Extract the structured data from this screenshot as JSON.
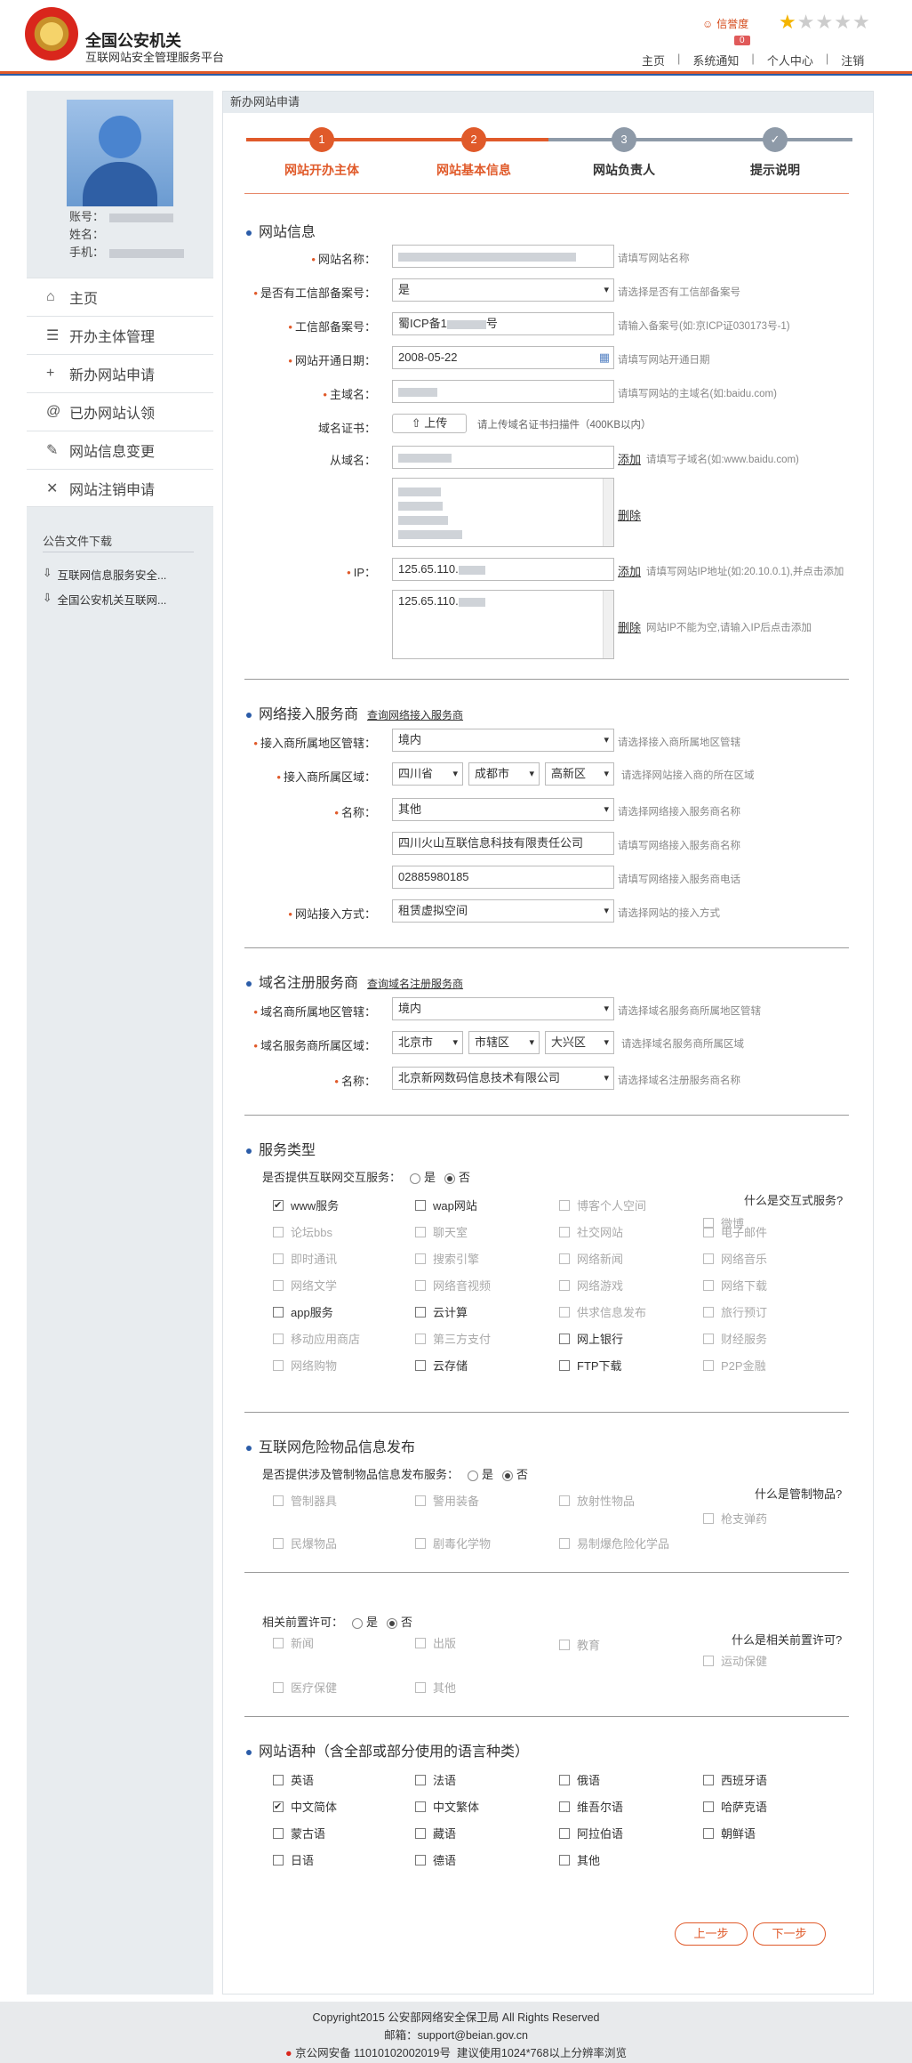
{
  "header": {
    "title": "全国公安机关",
    "subtitle": "互联网站安全管理服务平台",
    "credit_label": "信誉度",
    "credit_count": "0",
    "rating": 1,
    "rating_max": 5,
    "nav": [
      "主页",
      "系统通知",
      "个人中心",
      "注销"
    ]
  },
  "sidebar": {
    "account_label": "账号：",
    "name_label": "姓名：",
    "phone_label": "手机：",
    "menu": [
      {
        "icon": "home-icon",
        "glyph": "⌂",
        "label": "主页"
      },
      {
        "icon": "list-icon",
        "glyph": "☰",
        "label": "开办主体管理"
      },
      {
        "icon": "plus-icon",
        "glyph": "+",
        "label": "新办网站申请"
      },
      {
        "icon": "at-icon",
        "glyph": "@",
        "label": "已办网站认领"
      },
      {
        "icon": "edit-icon",
        "glyph": "✎",
        "label": "网站信息变更"
      },
      {
        "icon": "close-icon",
        "glyph": "✕",
        "label": "网站注销申请"
      }
    ],
    "notice_title": "公告文件下载",
    "docs": [
      "互联网信息服务安全...",
      "全国公安机关互联网..."
    ]
  },
  "main": {
    "breadcrumb": "新办网站申请",
    "steps": [
      {
        "num": "1",
        "label": "网站开办主体",
        "state": "done"
      },
      {
        "num": "2",
        "label": "网站基本信息",
        "state": "active"
      },
      {
        "num": "3",
        "label": "网站负责人",
        "state": "todo"
      },
      {
        "num": "✓",
        "label": "提示说明",
        "state": "todo"
      }
    ]
  },
  "site_info": {
    "title": "网站信息",
    "name_label": "网站名称：",
    "name_hint": "请填写网站名称",
    "icp_q_label": "是否有工信部备案号：",
    "icp_q_value": "是",
    "icp_q_hint": "请选择是否有工信部备案号",
    "icp_label": "工信部备案号：",
    "icp_prefix": "蜀ICP备1",
    "icp_suffix": "号",
    "icp_hint": "请输入备案号(如:京ICP证030173号-1)",
    "date_label": "网站开通日期：",
    "date_value": "2008-05-22",
    "date_hint": "请填写网站开通日期",
    "domain_label": "主域名：",
    "domain_hint": "请填写网站的主域名(如:baidu.com)",
    "cert_label": "域名证书：",
    "upload_label": "上传",
    "cert_hint": "请上传域名证书扫描件（400KB以内）",
    "subdomain_label": "从域名：",
    "add_label": "添加",
    "subdomain_hint": "请填写子域名(如:www.baidu.com)",
    "delete_label": "删除",
    "ip_label": "IP：",
    "ip_value": "125.65.110.",
    "ip_hint": "请填写网站IP地址(如:20.10.0.1),并点击添加",
    "ip_list_value": "125.65.110.",
    "ip_list_hint": "网站IP不能为空,请输入IP后点击添加"
  },
  "isp": {
    "title": "网络接入服务商",
    "query_link": "查询网络接入服务商",
    "region_label": "接入商所属地区管辖：",
    "region_value": "境内",
    "region_hint": "请选择接入商所属地区管辖",
    "area_label": "接入商所属区域：",
    "province": "四川省",
    "city": "成都市",
    "district": "高新区",
    "area_hint": "请选择网站接入商的所在区域",
    "name_label": "名称：",
    "name_value": "其他",
    "name_hint": "请选择网络接入服务商名称",
    "company_value": "四川火山互联信息科技有限责任公司",
    "company_hint": "请填写网络接入服务商名称",
    "phone_value": "02885980185",
    "phone_hint": "请填写网络接入服务商电话",
    "mode_label": "网站接入方式：",
    "mode_value": "租赁虚拟空间",
    "mode_hint": "请选择网站的接入方式"
  },
  "registrar": {
    "title": "域名注册服务商",
    "query_link": "查询域名注册服务商",
    "region_label": "域名商所属地区管辖：",
    "region_value": "境内",
    "region_hint": "请选择域名服务商所属地区管辖",
    "area_label": "域名服务商所属区域：",
    "province": "北京市",
    "city": "市辖区",
    "district": "大兴区",
    "area_hint": "请选择域名服务商所属区域",
    "name_label": "名称：",
    "name_value": "北京新网数码信息技术有限公司",
    "name_hint": "请选择域名注册服务商名称"
  },
  "service": {
    "title": "服务类型",
    "question": "是否提供互联网交互服务：",
    "yes": "是",
    "no": "否",
    "what": "什么是交互式服务?",
    "items": [
      {
        "label": "www服务",
        "checked": true,
        "disabled": false
      },
      {
        "label": "wap网站",
        "checked": false,
        "disabled": false
      },
      {
        "label": "博客个人空间",
        "checked": false,
        "disabled": true
      },
      {
        "label": "微博",
        "checked": false,
        "disabled": true
      },
      {
        "label": "论坛bbs",
        "checked": false,
        "disabled": true
      },
      {
        "label": "聊天室",
        "checked": false,
        "disabled": true
      },
      {
        "label": "社交网站",
        "checked": false,
        "disabled": true
      },
      {
        "label": "电子邮件",
        "checked": false,
        "disabled": true
      },
      {
        "label": "即时通讯",
        "checked": false,
        "disabled": true
      },
      {
        "label": "搜索引擎",
        "checked": false,
        "disabled": true
      },
      {
        "label": "网络新闻",
        "checked": false,
        "disabled": true
      },
      {
        "label": "网络音乐",
        "checked": false,
        "disabled": true
      },
      {
        "label": "网络文学",
        "checked": false,
        "disabled": true
      },
      {
        "label": "网络音视频",
        "checked": false,
        "disabled": true
      },
      {
        "label": "网络游戏",
        "checked": false,
        "disabled": true
      },
      {
        "label": "网络下载",
        "checked": false,
        "disabled": true
      },
      {
        "label": "app服务",
        "checked": false,
        "disabled": false
      },
      {
        "label": "云计算",
        "checked": false,
        "disabled": false
      },
      {
        "label": "供求信息发布",
        "checked": false,
        "disabled": true
      },
      {
        "label": "旅行预订",
        "checked": false,
        "disabled": true
      },
      {
        "label": "移动应用商店",
        "checked": false,
        "disabled": true
      },
      {
        "label": "第三方支付",
        "checked": false,
        "disabled": true
      },
      {
        "label": "网上银行",
        "checked": false,
        "disabled": false
      },
      {
        "label": "财经服务",
        "checked": false,
        "disabled": true
      },
      {
        "label": "网络购物",
        "checked": false,
        "disabled": true
      },
      {
        "label": "云存储",
        "checked": false,
        "disabled": false
      },
      {
        "label": "FTP下载",
        "checked": false,
        "disabled": false
      },
      {
        "label": "P2P金融",
        "checked": false,
        "disabled": true
      }
    ]
  },
  "danger": {
    "title": "互联网危险物品信息发布",
    "question": "是否提供涉及管制物品信息发布服务：",
    "yes": "是",
    "no": "否",
    "what": "什么是管制物品?",
    "items": [
      "管制器具",
      "警用装备",
      "放射性物品",
      "枪支弹药",
      "民爆物品",
      "剧毒化学物",
      "易制爆危险化学品"
    ]
  },
  "permit": {
    "question": "相关前置许可：",
    "yes": "是",
    "no": "否",
    "what": "什么是相关前置许可?",
    "items": [
      "新闻",
      "出版",
      "教育",
      "运动保健",
      "医疗保健",
      "其他"
    ]
  },
  "language": {
    "title": "网站语种（含全部或部分使用的语言种类）",
    "items": [
      {
        "label": "英语",
        "checked": false
      },
      {
        "label": "法语",
        "checked": false
      },
      {
        "label": "俄语",
        "checked": false
      },
      {
        "label": "西班牙语",
        "checked": false
      },
      {
        "label": "中文简体",
        "checked": true
      },
      {
        "label": "中文繁体",
        "checked": false
      },
      {
        "label": "维吾尔语",
        "checked": false
      },
      {
        "label": "哈萨克语",
        "checked": false
      },
      {
        "label": "蒙古语",
        "checked": false
      },
      {
        "label": "藏语",
        "checked": false
      },
      {
        "label": "阿拉伯语",
        "checked": false
      },
      {
        "label": "朝鲜语",
        "checked": false
      },
      {
        "label": "日语",
        "checked": false
      },
      {
        "label": "德语",
        "checked": false
      },
      {
        "label": "其他",
        "checked": false
      }
    ]
  },
  "buttons": {
    "prev": "上一步",
    "next": "下一步"
  },
  "footer": {
    "copyright": "Copyright2015 公安部网络安全保卫局 All Rights Reserved",
    "email": "邮箱：support@beian.gov.cn",
    "record": "京公网安备 11010102002019号",
    "advice": "建议使用1024*768以上分辨率浏览"
  },
  "colors": {
    "accent": "#e05a2a",
    "blue": "#2b5ca8",
    "step_gray": "#8e9aa8"
  }
}
